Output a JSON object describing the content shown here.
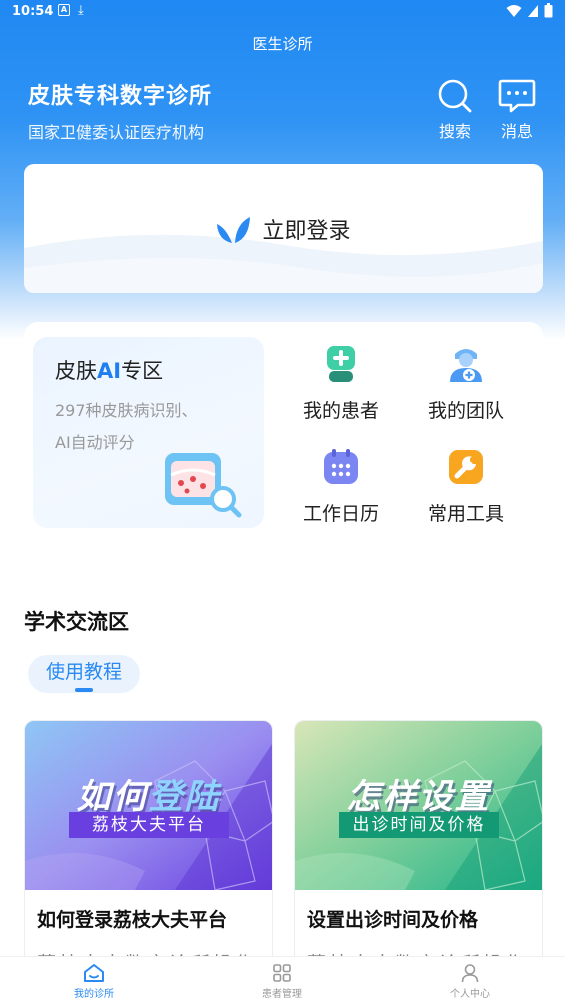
{
  "status_bar": {
    "time": "10:54",
    "icon_a": "A",
    "download_glyph": "⤓"
  },
  "nav": {
    "title": "医生诊所"
  },
  "header": {
    "clinic_name": "皮肤专科数字诊所",
    "clinic_sub": "国家卫健委认证医疗机构",
    "search_label": "搜索",
    "message_label": "消息"
  },
  "login": {
    "label": "立即登录"
  },
  "ai_zone": {
    "title_pre": "皮肤",
    "title_ai": "AI",
    "title_post": "专区",
    "desc_line1": "297种皮肤病识别、",
    "desc_line2": "AI自动评分"
  },
  "quick_menu": {
    "patients": "我的患者",
    "team": "我的团队",
    "calendar": "工作日历",
    "tools": "常用工具"
  },
  "academic": {
    "section_title": "学术交流区",
    "tab_label": "使用教程"
  },
  "courses": [
    {
      "thumb_title_a": "如何",
      "thumb_title_b": "登陆",
      "thumb_sub": "荔枝大夫平台",
      "title": "如何登录荔枝大夫平台",
      "desc": "荔枝大夫数字诊所操作"
    },
    {
      "thumb_title_a": "怎样",
      "thumb_title_b": "设置",
      "thumb_sub": "出诊时间及价格",
      "title": "设置出诊时间及价格",
      "desc": "荔枝大夫数字诊所操作"
    }
  ],
  "bottom_nav": {
    "clinic": "我的诊所",
    "patients": "患者管理",
    "profile": "个人中心"
  },
  "colors": {
    "primary": "#2b8af2",
    "header_top": "#1f88f2",
    "ai_accent": "#1f7ff0"
  }
}
